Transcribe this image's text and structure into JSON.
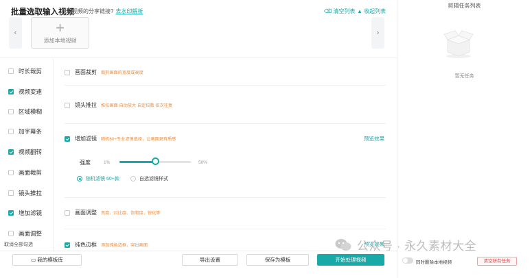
{
  "header": {
    "title": "批量选取输入视频",
    "hint": "短视频的分享链接?",
    "hint_link": "去水印解析",
    "clear_list": "清空列表",
    "collapse_list": "收起列表"
  },
  "upload": {
    "add_label": "添加本地视频"
  },
  "sidebar": {
    "items": [
      {
        "label": "时长裁剪",
        "checked": false
      },
      {
        "label": "视频变速",
        "checked": true
      },
      {
        "label": "区域模糊",
        "checked": false
      },
      {
        "label": "加字幕条",
        "checked": false
      },
      {
        "label": "视频翻转",
        "checked": true
      },
      {
        "label": "画面裁剪",
        "checked": false
      },
      {
        "label": "镜头推拉",
        "checked": false
      },
      {
        "label": "增加滤镜",
        "checked": true
      },
      {
        "label": "画面调整",
        "checked": false
      }
    ],
    "footer": "取消全部勾选"
  },
  "features": [
    {
      "label": "画面裁剪",
      "desc": "裁剪画面的宽度或高度",
      "checked": false
    },
    {
      "label": "镜头推拉",
      "desc": "推拉画面 自动放大 自定倍数 依次往复",
      "checked": false
    },
    {
      "label": "增加滤镜",
      "desc": "随机60+专业滤镜选择，让画面更有质感",
      "checked": true
    },
    {
      "label": "画面调整",
      "desc": "亮度、对比度、饱和度、锐化等",
      "checked": false
    },
    {
      "label": "纯色边框",
      "desc": "添加纯色边框，突出画面",
      "checked": true
    }
  ],
  "filter": {
    "preview_label": "预览效果",
    "strength_label": "强度",
    "min_label": "1%",
    "max_label": "50%",
    "strength_value": 0.5,
    "radio_random": "随机滤镜 60+款",
    "radio_custom": "自选滤镜样式"
  },
  "border_preview": "预览效果",
  "footer": {
    "templates": "我的模板库",
    "export": "导出设置",
    "save_template": "保存为模板",
    "start": "开始处理视频"
  },
  "tasks": {
    "title": "剪辑任务列表",
    "empty": "暂无任务",
    "toggle_label": "同时删除本地视频",
    "clear_all": "清空所有任务"
  },
  "watermark": "公众号 · 永久素材大全",
  "colors": {
    "accent": "#18a9a8",
    "desc": "#f08c3b",
    "danger": "#e04848"
  }
}
